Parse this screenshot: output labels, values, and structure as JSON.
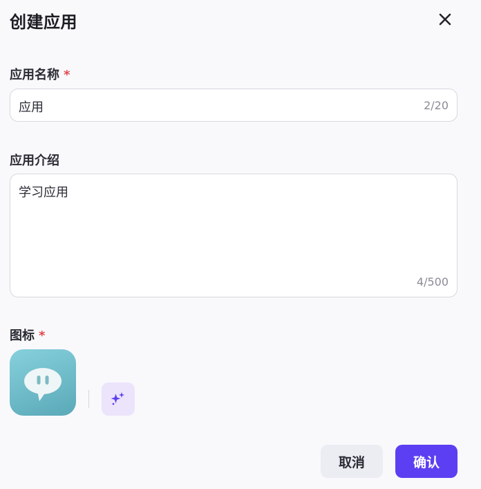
{
  "dialog": {
    "title": "创建应用",
    "close_icon": "close-icon"
  },
  "name_field": {
    "label": "应用名称",
    "required_mark": "*",
    "value": "应用",
    "counter": "2/20"
  },
  "intro_field": {
    "label": "应用介绍",
    "value": "学习应用",
    "counter": "4/500"
  },
  "icon_field": {
    "label": "图标",
    "required_mark": "*",
    "app_icon": "chat-bubble-icon",
    "generate_icon": "sparkle-icon"
  },
  "footer": {
    "cancel_label": "取消",
    "confirm_label": "确认"
  },
  "colors": {
    "accent": "#5c3ff2",
    "required": "#e5484d",
    "background": "#f9f9fc"
  }
}
